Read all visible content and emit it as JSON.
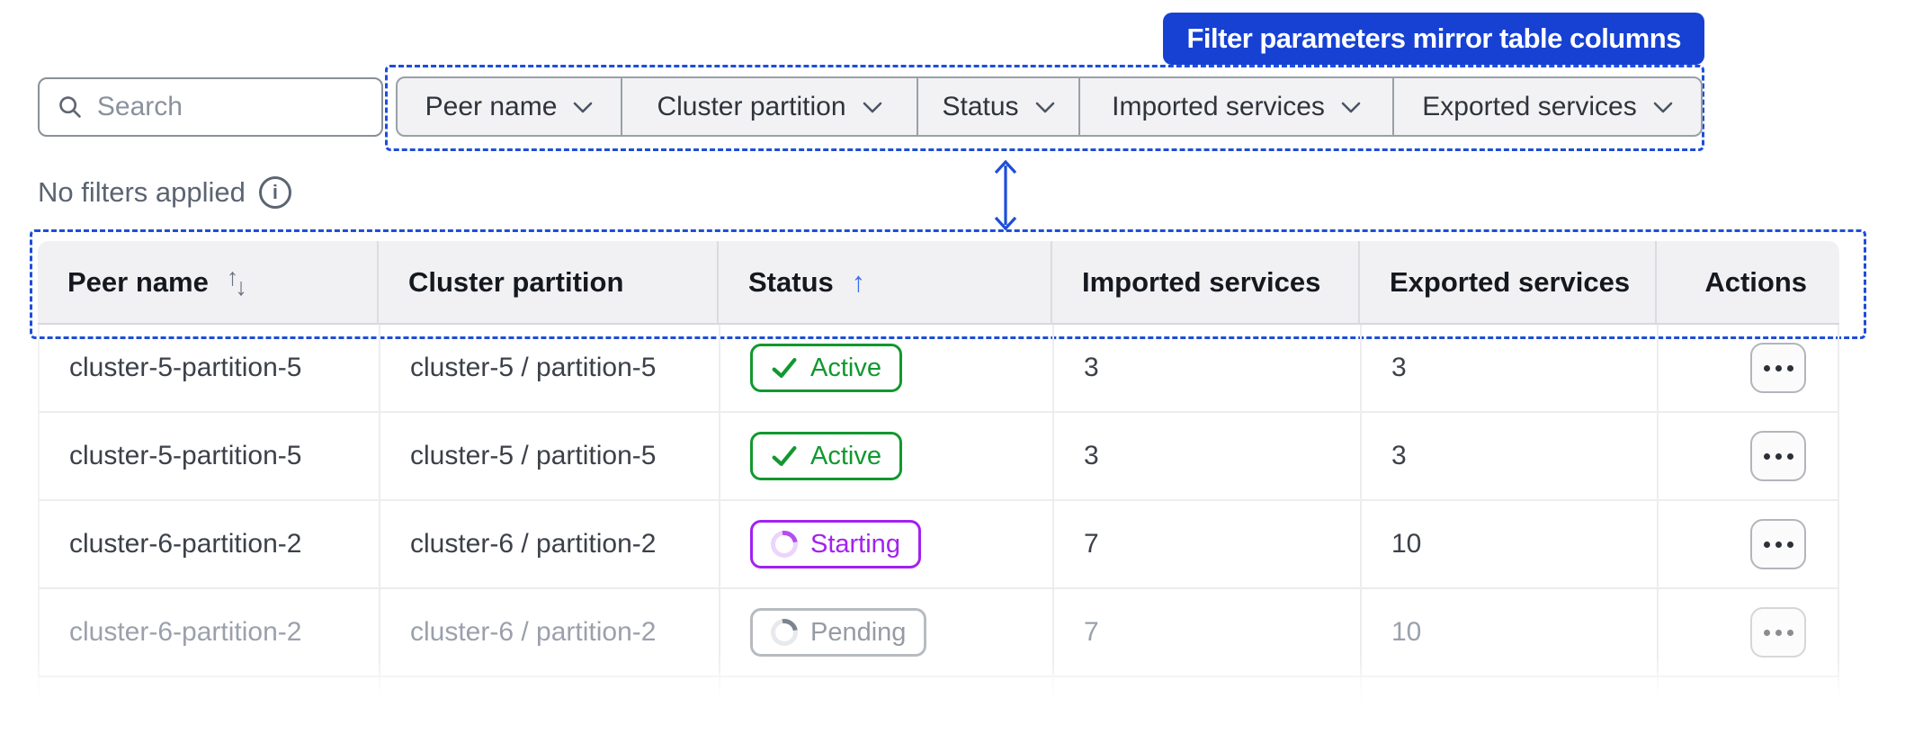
{
  "annotation": {
    "banner_label": "Filter parameters mirror table columns",
    "banner_color": "#1641d3",
    "outline_color": "#1d4ed8"
  },
  "filter_bar": {
    "search": {
      "placeholder": "Search",
      "value": ""
    },
    "filters": [
      {
        "label": "Peer name"
      },
      {
        "label": "Cluster partition"
      },
      {
        "label": "Status"
      },
      {
        "label": "Imported services"
      },
      {
        "label": "Exported services"
      }
    ],
    "status_text": "No filters applied"
  },
  "icons": {
    "search_icon": "magnifier",
    "info_icon": "i",
    "chevron_down_icon": "v-chevron",
    "sort_both_up": "↑",
    "sort_both_down": "↓",
    "sort_asc": "↑",
    "active_check_icon": "checkmark",
    "spinner_icon": "partial-arc",
    "actions_icon": "three-dots"
  },
  "table": {
    "columns": [
      {
        "label": "Peer name",
        "sort": "sortable"
      },
      {
        "label": "Cluster partition",
        "sort": "none"
      },
      {
        "label": "Status",
        "sort": "asc"
      },
      {
        "label": "Imported services",
        "sort": "none"
      },
      {
        "label": "Exported services",
        "sort": "none"
      },
      {
        "label": "Actions",
        "sort": "none"
      }
    ],
    "status_colors": {
      "Active": "#12982f",
      "Starting": "#a321f0",
      "Pending": "#6e7681"
    },
    "rows": [
      {
        "peer_name": "cluster-5-partition-5",
        "cluster_partition": "cluster-5 / partition-5",
        "status": "Active",
        "status_variant": "active",
        "imported_services": "3",
        "exported_services": "3",
        "muted": false
      },
      {
        "peer_name": "cluster-5-partition-5",
        "cluster_partition": "cluster-5 / partition-5",
        "status": "Active",
        "status_variant": "active",
        "imported_services": "3",
        "exported_services": "3",
        "muted": false
      },
      {
        "peer_name": "cluster-6-partition-2",
        "cluster_partition": "cluster-6 / partition-2",
        "status": "Starting",
        "status_variant": "starting",
        "imported_services": "7",
        "exported_services": "10",
        "muted": false
      },
      {
        "peer_name": "cluster-6-partition-2",
        "cluster_partition": "cluster-6 / partition-2",
        "status": "Pending",
        "status_variant": "pending",
        "imported_services": "7",
        "exported_services": "10",
        "muted": true
      }
    ]
  }
}
